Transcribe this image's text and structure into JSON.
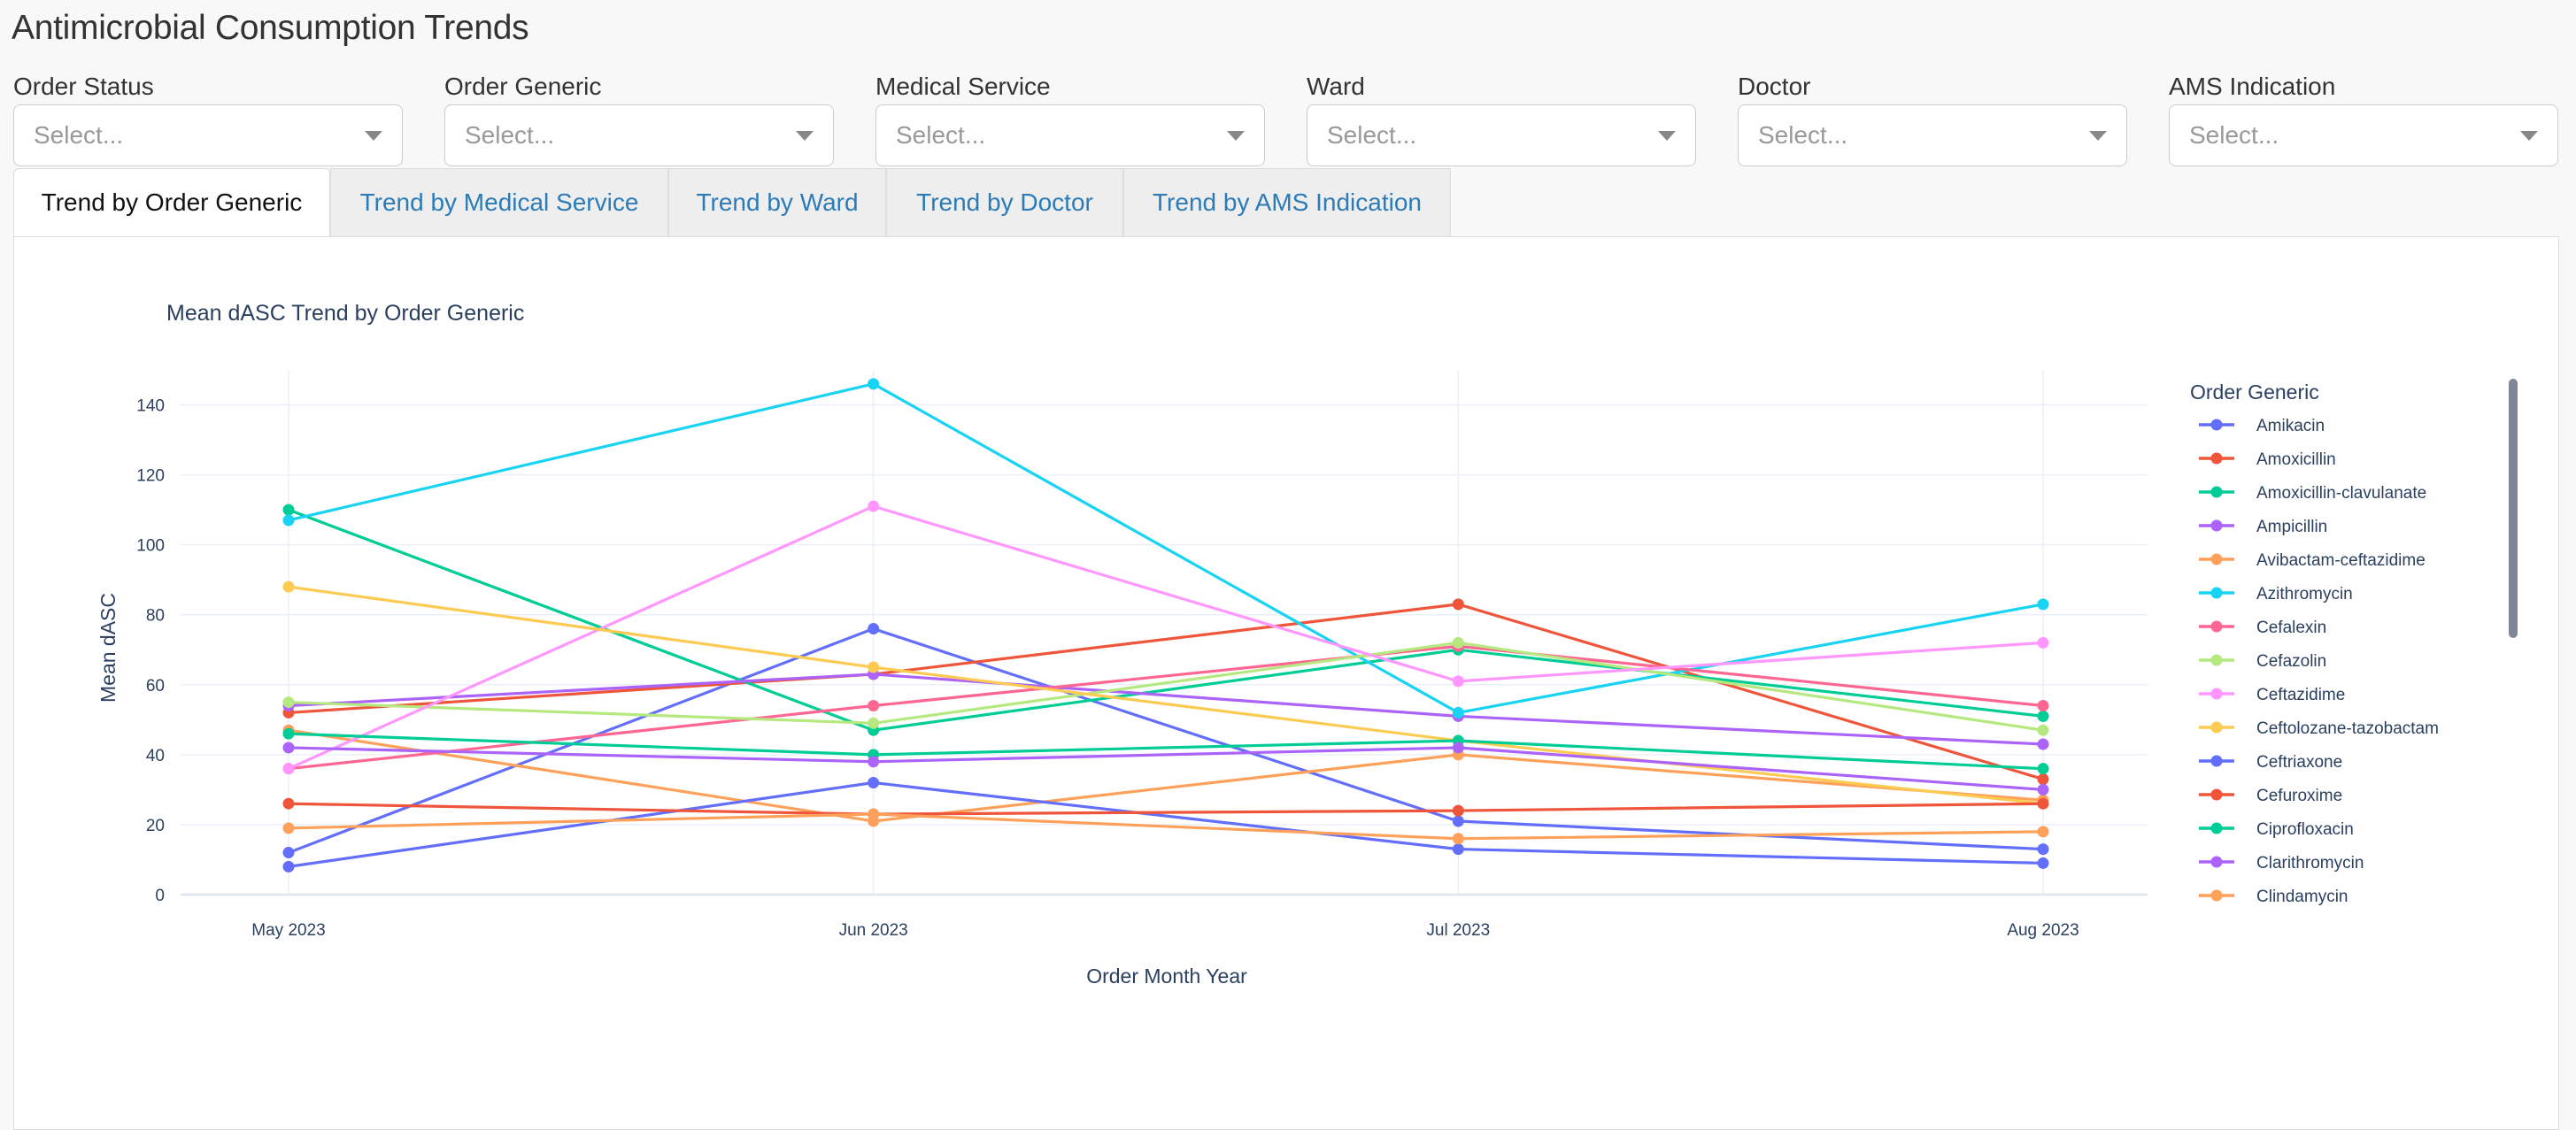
{
  "page": {
    "title": "Antimicrobial Consumption Trends"
  },
  "filters": [
    {
      "label": "Order Status",
      "placeholder": "Select..."
    },
    {
      "label": "Order Generic",
      "placeholder": "Select..."
    },
    {
      "label": "Medical Service",
      "placeholder": "Select..."
    },
    {
      "label": "Ward",
      "placeholder": "Select..."
    },
    {
      "label": "Doctor",
      "placeholder": "Select..."
    },
    {
      "label": "AMS Indication",
      "placeholder": "Select..."
    }
  ],
  "tabs": [
    {
      "label": "Trend by Order Generic",
      "active": true
    },
    {
      "label": "Trend by Medical Service",
      "active": false
    },
    {
      "label": "Trend by Ward",
      "active": false
    },
    {
      "label": "Trend by Doctor",
      "active": false
    },
    {
      "label": "Trend by AMS Indication",
      "active": false
    }
  ],
  "chart_data": {
    "type": "line",
    "title": "Mean dASC Trend by Order Generic",
    "xlabel": "Order Month Year",
    "ylabel": "Mean dASC",
    "x": [
      "May 2023",
      "Jun 2023",
      "Jul 2023",
      "Aug 2023"
    ],
    "ylim": [
      0,
      150
    ],
    "y_ticks": [
      0,
      20,
      40,
      60,
      80,
      100,
      120,
      140
    ],
    "grid": true,
    "legend_title": "Order Generic",
    "legend_position": "right",
    "series": [
      {
        "name": "Amikacin",
        "color": "#636efa",
        "values": [
          12,
          76,
          21,
          13
        ]
      },
      {
        "name": "Amoxicillin",
        "color": "#ef553b",
        "values": [
          52,
          63,
          83,
          33
        ]
      },
      {
        "name": "Amoxicillin-clavulanate",
        "color": "#00cc96",
        "values": [
          110,
          47,
          70,
          51
        ]
      },
      {
        "name": "Ampicillin",
        "color": "#ab63fa",
        "values": [
          54,
          63,
          51,
          43
        ]
      },
      {
        "name": "Avibactam-ceftazidime",
        "color": "#ffa15a",
        "values": [
          47,
          21,
          40,
          27
        ]
      },
      {
        "name": "Azithromycin",
        "color": "#19d3f3",
        "values": [
          107,
          146,
          52,
          83
        ]
      },
      {
        "name": "Cefalexin",
        "color": "#ff6692",
        "values": [
          36,
          54,
          71,
          54
        ]
      },
      {
        "name": "Cefazolin",
        "color": "#b6e880",
        "values": [
          55,
          49,
          72,
          47
        ]
      },
      {
        "name": "Ceftazidime",
        "color": "#ff97ff",
        "values": [
          36,
          111,
          61,
          72
        ]
      },
      {
        "name": "Ceftolozane-tazobactam",
        "color": "#fecb52",
        "values": [
          88,
          65,
          44,
          26
        ]
      },
      {
        "name": "Ceftriaxone",
        "color": "#636efa",
        "values": [
          8,
          32,
          13,
          9
        ]
      },
      {
        "name": "Cefuroxime",
        "color": "#ef553b",
        "values": [
          26,
          23,
          24,
          26
        ]
      },
      {
        "name": "Ciprofloxacin",
        "color": "#00cc96",
        "values": [
          46,
          40,
          44,
          36
        ]
      },
      {
        "name": "Clarithromycin",
        "color": "#ab63fa",
        "values": [
          42,
          38,
          42,
          30
        ]
      },
      {
        "name": "Clindamycin",
        "color": "#ffa15a",
        "values": [
          19,
          23,
          16,
          18
        ]
      }
    ]
  }
}
